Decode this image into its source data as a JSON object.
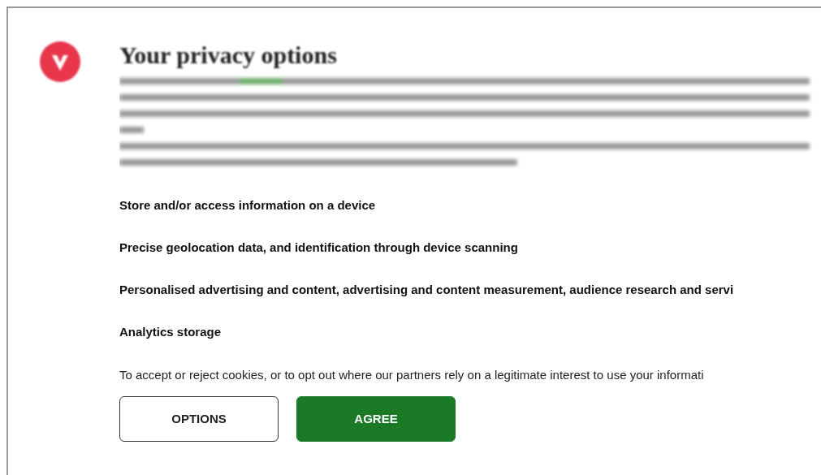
{
  "dialog": {
    "title": "Your privacy options",
    "purposes": [
      "Store and/or access information on a device",
      "Precise geolocation data, and identification through device scanning",
      "Personalised advertising and content, advertising and content measurement, audience research and servi",
      "Analytics storage"
    ],
    "notice": "To accept or reject cookies, or to opt out where our partners rely on a legitimate interest to use your informati",
    "buttons": [
      {
        "label": "OPTIONS",
        "kind": "outline"
      },
      {
        "label": "AGREE",
        "kind": "primary"
      }
    ]
  }
}
